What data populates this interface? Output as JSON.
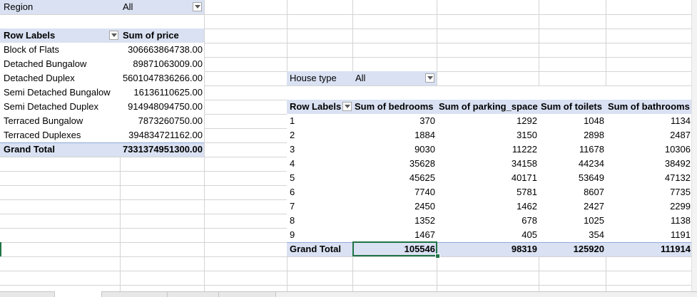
{
  "pivot1": {
    "filter_label": "Region",
    "filter_value": "All",
    "row_labels_header": "Row Labels",
    "value_header": "Sum of price",
    "rows": [
      {
        "label": "Block of Flats",
        "value": "306663864738.00"
      },
      {
        "label": "Detached Bungalow",
        "value": "89871063009.00"
      },
      {
        "label": "Detached Duplex",
        "value": "5601047836266.00"
      },
      {
        "label": "Semi Detached Bungalow",
        "value": "16136110625.00"
      },
      {
        "label": "Semi Detached Duplex",
        "value": "914948094750.00"
      },
      {
        "label": "Terraced Bungalow",
        "value": "7873260750.00"
      },
      {
        "label": "Terraced Duplexes",
        "value": "394834721162.00"
      }
    ],
    "total_label": "Grand Total",
    "total_value": "7331374951300.00"
  },
  "pivot2": {
    "filter_label": "House type",
    "filter_value": "All",
    "headers": [
      "Row Labels",
      "Sum of bedrooms",
      "Sum of parking_space",
      "Sum of toilets",
      "Sum of bathrooms"
    ],
    "rows": [
      [
        "1",
        "370",
        "1292",
        "1048",
        "1134"
      ],
      [
        "2",
        "1884",
        "3150",
        "2898",
        "2487"
      ],
      [
        "3",
        "9030",
        "11222",
        "11678",
        "10306"
      ],
      [
        "4",
        "35628",
        "34158",
        "44234",
        "38492"
      ],
      [
        "5",
        "45625",
        "40171",
        "53649",
        "47132"
      ],
      [
        "6",
        "7740",
        "5781",
        "8607",
        "7735"
      ],
      [
        "7",
        "2450",
        "1462",
        "2427",
        "2299"
      ],
      [
        "8",
        "1352",
        "678",
        "1025",
        "1138"
      ],
      [
        "9",
        "1467",
        "405",
        "354",
        "1191"
      ]
    ],
    "total": [
      "Grand Total",
      "105546",
      "98319",
      "125920",
      "111914"
    ]
  },
  "colors": {
    "header_fill": "#d9e1f2",
    "selection": "#217346",
    "gridline": "#d4d4d4"
  }
}
